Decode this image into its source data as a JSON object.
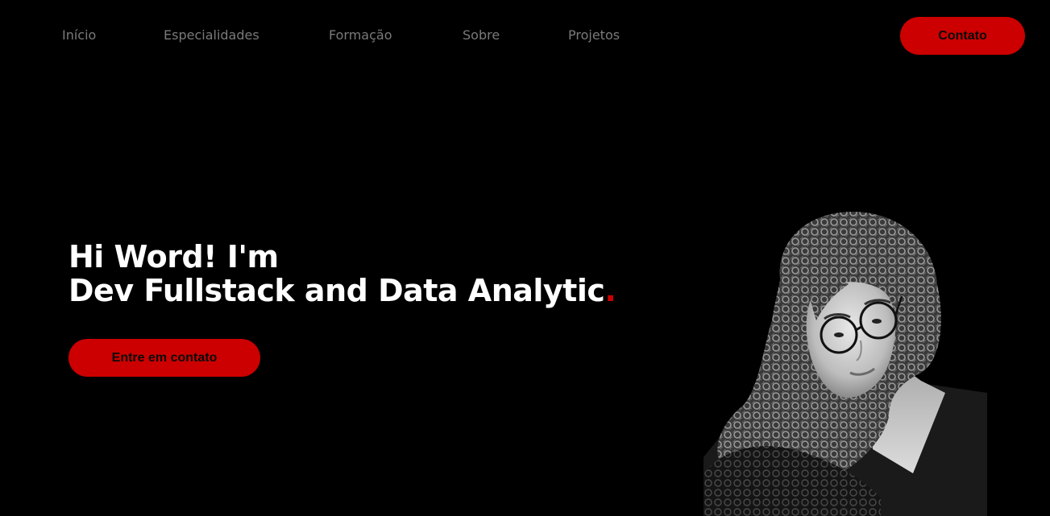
{
  "nav": {
    "links": [
      {
        "label": "Início"
      },
      {
        "label": "Especialidades"
      },
      {
        "label": "Formação"
      },
      {
        "label": "Sobre"
      },
      {
        "label": "Projetos"
      }
    ],
    "contact_label": "Contato"
  },
  "hero": {
    "line1": "Hi Word! I'm",
    "line2": "Dev Fullstack and Data Analytic",
    "dot": ".",
    "cta_label": "Entre em contato"
  },
  "colors": {
    "background": "#000000",
    "accent": "#cc0000",
    "nav_text": "#7a7a7a",
    "heading_text": "#ffffff"
  }
}
